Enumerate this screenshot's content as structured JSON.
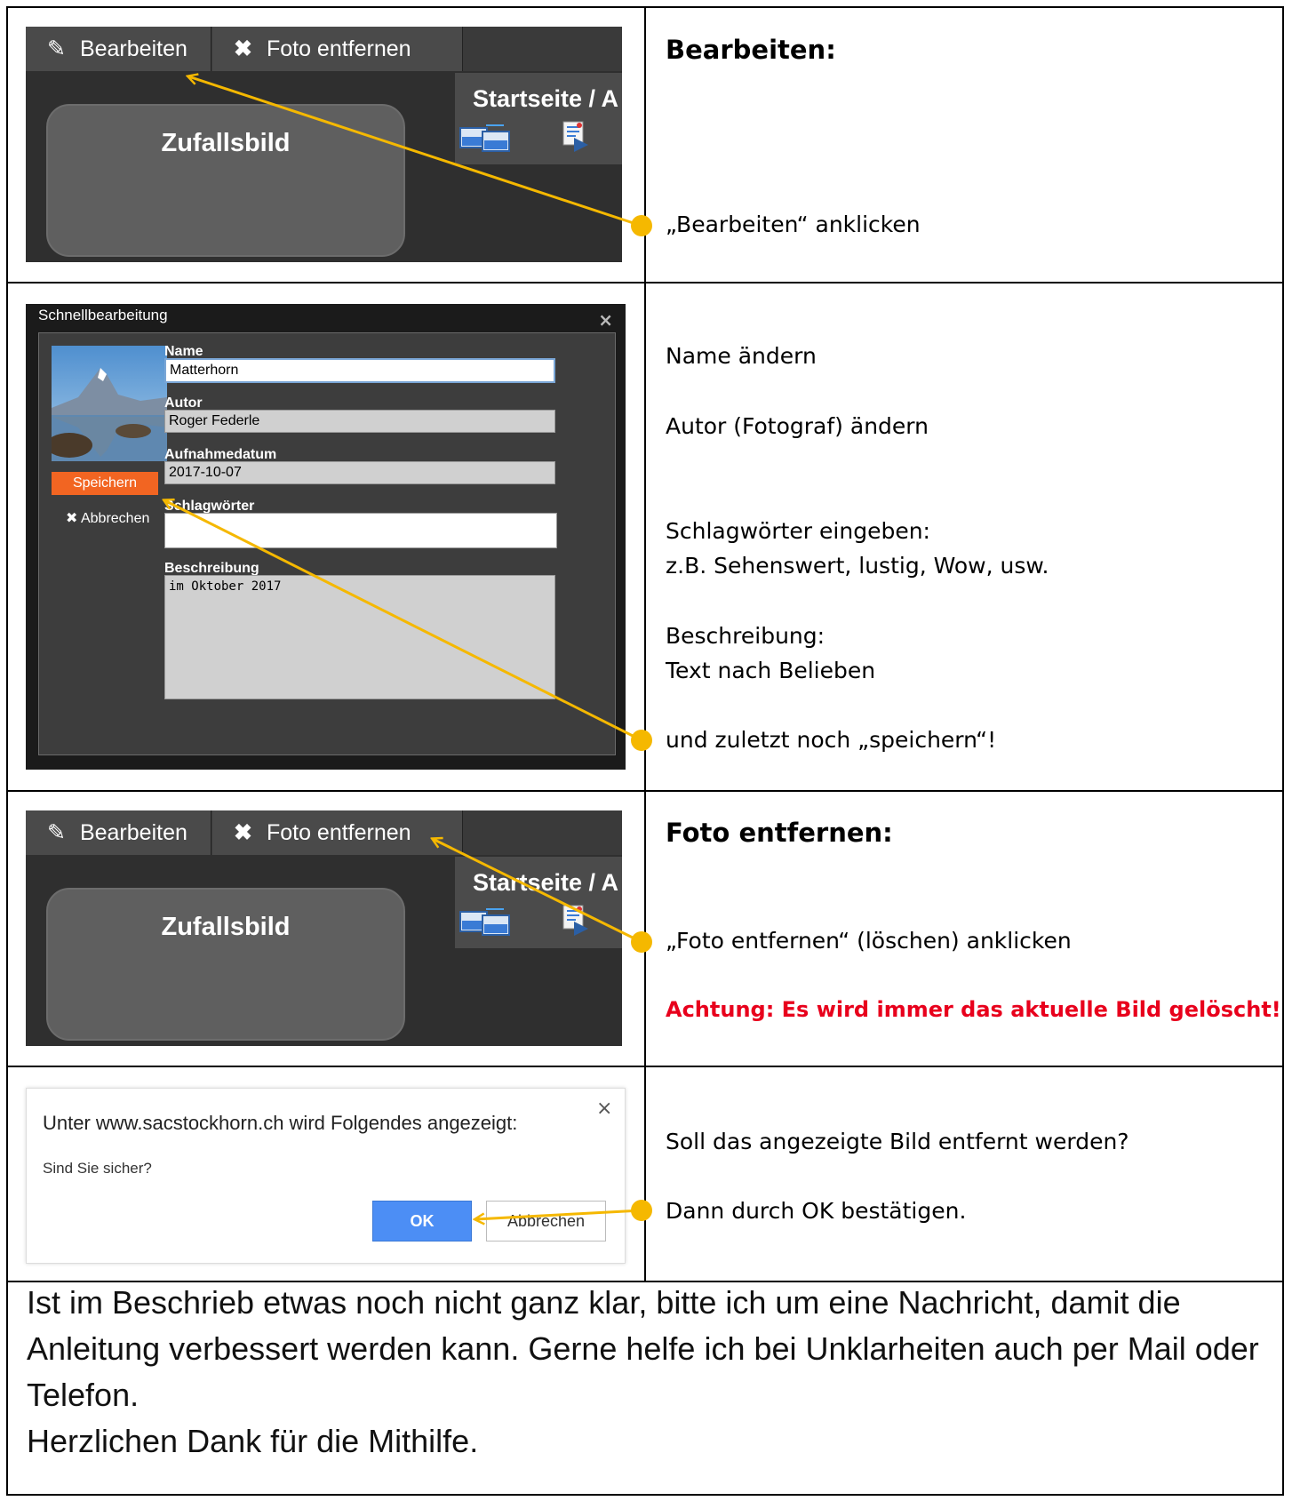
{
  "row1": {
    "screenshot": {
      "edit_button": "Bearbeiten",
      "remove_button": "Foto entfernen",
      "tile_label": "Zufallsbild",
      "breadcrumb": "Startseite / A"
    },
    "heading": "Bearbeiten:",
    "instruction": "„Bearbeiten“ anklicken"
  },
  "row2": {
    "dialog": {
      "title": "Schnellbearbeitung",
      "close": "×",
      "name_label": "Name",
      "name_value": "Matterhorn",
      "author_label": "Autor",
      "author_value": "Roger Federle",
      "date_label": "Aufnahmedatum",
      "date_value": "2017-10-07",
      "tags_label": "Schlagwörter",
      "tags_value": "",
      "desc_label": "Beschreibung",
      "desc_value": "im Oktober 2017",
      "save_button": "Speichern",
      "cancel_button": "✖ Abbrechen"
    },
    "lines": {
      "name": "Name ändern",
      "author": "Autor (Fotograf) ändern",
      "tags": "Schlagwörter eingeben:",
      "tags_example": "z.B. Sehenswert, lustig, Wow,  usw.",
      "desc": "Beschreibung:",
      "desc_detail": "Text nach Belieben",
      "save": "und zuletzt noch „speichern“!"
    }
  },
  "row3": {
    "screenshot": {
      "edit_button": "Bearbeiten",
      "remove_button": "Foto entfernen",
      "tile_label": "Zufallsbild",
      "breadcrumb": "Startseite / A"
    },
    "heading": "Foto entfernen:",
    "instruction": "„Foto entfernen“ (löschen) anklicken",
    "warning": "Achtung: Es wird immer das aktuelle Bild gelöscht!"
  },
  "row4": {
    "confirm": {
      "message": "Unter www.sacstockhorn.ch wird Folgendes angezeigt:",
      "question": "Sind Sie sicher?",
      "close": "×",
      "ok_button": "OK",
      "cancel_button": "Abbrechen"
    },
    "question": "Soll das angezeigte Bild entfernt werden?",
    "instruction": "Dann durch OK bestätigen."
  },
  "footer": {
    "line1": "Ist im Beschrieb etwas noch nicht ganz klar, bitte ich um eine Nachricht, damit die Anleitung verbessert werden kann. Gerne helfe ich bei Unklarheiten auch per Mail oder Telefon.",
    "line2": "Herzlichen Dank für die Mithilfe."
  },
  "colors": {
    "arrow": "#f5b800",
    "warning": "#e8001c",
    "save_button": "#f26522",
    "ok_button": "#4c8ef5"
  }
}
